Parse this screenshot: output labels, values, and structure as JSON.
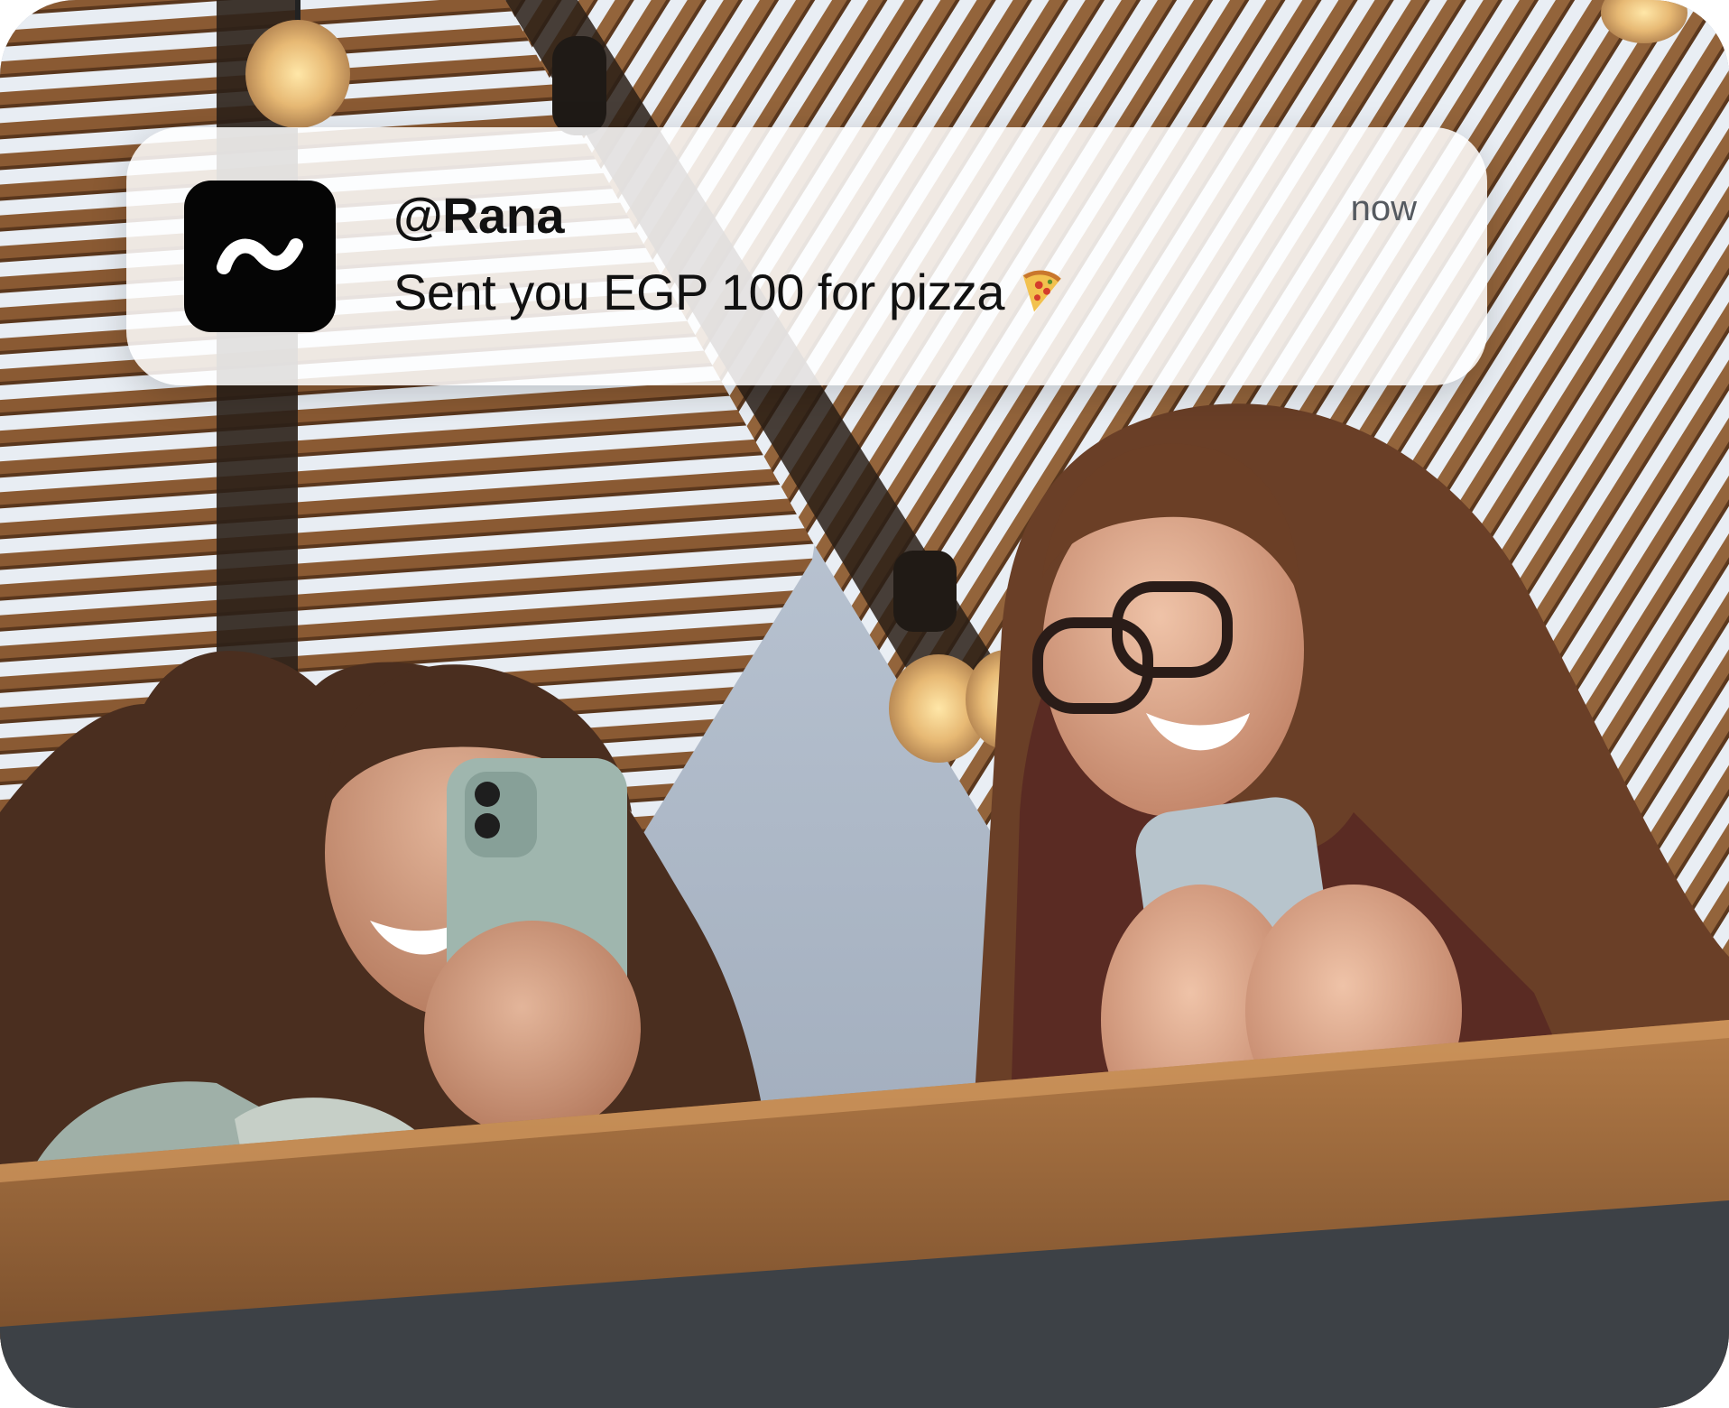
{
  "notification": {
    "app_icon": "tilde-logo-icon",
    "sender": "@Rana",
    "message": "Sent you EGP 100 for pizza",
    "emoji": "pizza-icon",
    "time": "now"
  },
  "photo": {
    "subject": "background-photo"
  },
  "colors": {
    "notification_bg": "#ffffffdb",
    "app_icon_bg": "#050505",
    "text": "#111111",
    "time_text": "#555a60",
    "wood": "#9a6a3e",
    "sky": "#dfe6f0"
  }
}
